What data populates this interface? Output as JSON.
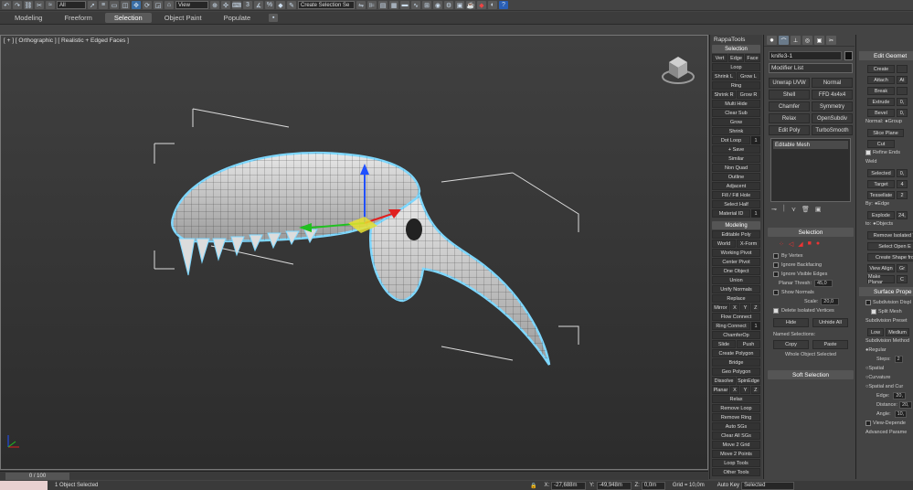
{
  "toolbar": {
    "selection_filter": "All",
    "ref_coord": "View",
    "named_selection": "Create Selection Se"
  },
  "ribbon": {
    "tabs": [
      "Modeling",
      "Freeform",
      "Selection",
      "Object Paint",
      "Populate"
    ],
    "active": "Selection"
  },
  "viewport": {
    "label": "[ + ] [ Orthographic ] [ Realistic + Edged Faces ]"
  },
  "rappa": {
    "title": "RappaTools",
    "sections": {
      "selection": "Selection",
      "modeling": "Modeling"
    },
    "buttons": {
      "vert": "Vert",
      "edge": "Edge",
      "face": "Face",
      "loop": "Loop",
      "shrink_l": "Shrink L",
      "grow_l": "Grow L",
      "ring": "Ring",
      "shrink_r": "Shrink R",
      "grow_r": "Grow R",
      "multi_hide": "Multi Hide",
      "clear_sub": "Clear Sub",
      "grow": "Grow",
      "shrink": "Shrink",
      "dot_loop": "Dot Loop",
      "dot_loop_val": "1",
      "save": "+ Save",
      "similar": "Similar",
      "non_quad": "Non Quad",
      "outline": "Outline",
      "adjacent": "Adjacent",
      "fill": "Fill / Fill Hole",
      "select_half": "Select Half",
      "material_id": "Material ID",
      "material_id_val": "1",
      "editable_poly": "Editable Poly",
      "world": "World",
      "x_form": "X-Form",
      "working_pivot": "Working Pivot",
      "center_pivot": "Center Pivot",
      "one_object": "One Object",
      "union": "Union",
      "unify_normals": "Unify Normals",
      "replace": "Replace",
      "mirror": "Mirror",
      "x": "X",
      "y": "Y",
      "z": "Z",
      "flow_connect": "Flow Connect",
      "ring_connect": "Ring Connect",
      "ring_connect_val": "1",
      "chamfer_op": "ChamferOp",
      "slide": "Slide",
      "push": "Push",
      "create_polygon": "Create Polygon",
      "bridge": "Bridge",
      "geo_polygon": "Geo Polygon",
      "dissolve": "Dissolve",
      "spin_edge": "SpinEdge",
      "planar": "Planar",
      "relax": "Relax",
      "remove_loop": "Remove Loop",
      "remove_ring": "Remove Ring",
      "auto_sgs": "Auto SGs",
      "clear_all_sgs": "Clear All SGs",
      "move_2_grid": "Move 2 Grid",
      "move_2_points": "Move 2 Points",
      "loop_tools": "Loop Tools",
      "other_tools": "Other Tools"
    }
  },
  "command_panel": {
    "object_name": "knife3-1",
    "modifier_list": "Modifier List",
    "mod_buttons": [
      "Unwrap UVW",
      "Normal",
      "Shell",
      "FFD 4x4x4",
      "Chamfer",
      "Symmetry",
      "Relax",
      "OpenSubdiv",
      "Edit Poly",
      "TurboSmooth"
    ],
    "stack_item": "Editable Mesh",
    "selection_rollout": "Selection",
    "by_vertex": "By Vertex",
    "ignore_backfacing": "Ignore Backfacing",
    "ignore_visible_edges": "Ignore Visible Edges",
    "planar_thresh_label": "Planar Thresh:",
    "planar_thresh_val": "45,0",
    "show_normals": "Show Normals",
    "scale_label": "Scale:",
    "scale_val": "20,0",
    "delete_isolated": "Delete Isolated Vertices",
    "hide": "Hide",
    "unhide_all": "Unhide All",
    "named_selections": "Named Selections:",
    "copy": "Copy",
    "paste": "Paste",
    "whole_object_selected": "Whole Object Selected",
    "soft_selection": "Soft Selection"
  },
  "edit_geometry": {
    "title": "Edit Geomet",
    "create": "Create",
    "attach": "Attach",
    "at": "At",
    "break": "Break",
    "extrude": "Extrude",
    "extrude_val": "0,",
    "bevel": "Bevel",
    "bevel_val": "0,",
    "normal_label": "Normal:",
    "group": "Group",
    "slice_plane": "Slice Plane",
    "cut": "Cut",
    "refine_ends": "Refine Ends",
    "weld": "Weld",
    "selected": "Selected",
    "selected_val": "0,",
    "target": "Target",
    "target_val": "4",
    "tessellate": "Tessellate",
    "tessellate_val": "2",
    "by": "By:",
    "edge": "Edge",
    "explode": "Explode",
    "explode_val": "24,",
    "to": "to:",
    "objects": "Objects",
    "remove_isolated": "Remove Isolated V",
    "select_open": "Select Open E",
    "create_shape": "Create Shape fro",
    "view_align": "View Align",
    "gr": "Gr",
    "make_planar": "Make Planar",
    "c": "C",
    "surface_props": "Surface Prope",
    "subdiv_displ": "Subdivision Displ",
    "split_mesh": "Split Mesh",
    "subdiv_presets": "Subdivision Preset",
    "low": "Low",
    "medium": "Medium",
    "subdiv_method": "Subdivision Method",
    "regular": "Regular",
    "steps": "Steps:",
    "steps_val": "2",
    "spatial": "Spatial",
    "curvature": "Curvature",
    "spatial_curv": "Spatial and Cur",
    "edge_label": "Edge:",
    "edge_val": "20,",
    "distance": "Distance:",
    "distance_val": "20,",
    "angle": "Angle:",
    "angle_val": "10,",
    "view_dependent": "View-Depende",
    "advanced_params": "Advanced Parame"
  },
  "timeline": {
    "slider": "0 / 100"
  },
  "status": {
    "objects_selected": "1 Object Selected",
    "x_label": "X:",
    "x_val": "-27,688m",
    "y_label": "Y:",
    "y_val": "-49,948m",
    "z_label": "Z:",
    "z_val": "0,0m",
    "grid": "Grid = 10,0m",
    "auto_key": "Auto Key",
    "key_mode": "Selected"
  },
  "colors": {
    "viewport_top": "#404040",
    "viewport_bottom": "#2c2c2c",
    "selection_outline": "#7fd8ff",
    "gizmo_x": "#e02020",
    "gizmo_y": "#20c020",
    "gizmo_z": "#2050ff"
  }
}
